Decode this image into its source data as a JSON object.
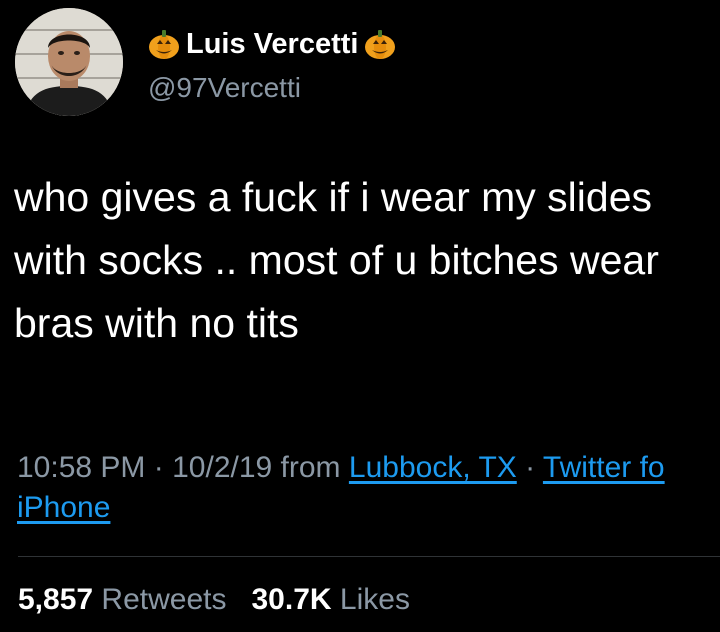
{
  "author": {
    "display_name": "Luis Vercetti",
    "handle": "@97Vercetti",
    "name_emoji": "pumpkin-emoji-icon"
  },
  "tweet": {
    "lines": [
      "who gives a fuck if i wear my slides",
      "with socks .. most of u bitches wear",
      "bras with no tits"
    ]
  },
  "meta": {
    "time": "10:58 PM",
    "date": "10/2/19",
    "from_label": "from",
    "location": "Lubbock, TX",
    "client": "Twitter for iPhone",
    "client_line1": "Twitter fo",
    "client_line2": "iPhone",
    "separator": "·"
  },
  "stats": {
    "retweets_count": "5,857",
    "retweets_label": "Retweets",
    "likes_count": "30.7K",
    "likes_label": "Likes"
  },
  "colors": {
    "background": "#000000",
    "text": "#ffffff",
    "secondary": "#8b98a5",
    "link": "#1d9bf0"
  }
}
